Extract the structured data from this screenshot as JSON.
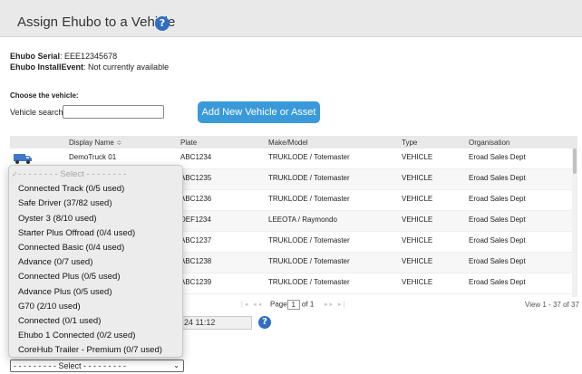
{
  "page": {
    "title": "Assign Ehubo to a Vehicle",
    "help_glyph": "?"
  },
  "info": {
    "serial_label": "Ehubo Serial",
    "serial_value": "EEE12345678",
    "install_label": "Ehubo InstallEvent",
    "install_value": "Not currently available"
  },
  "vehicle": {
    "choose_label": "Choose the vehicle:",
    "search_label": "Vehicle search",
    "search_value": "",
    "add_button": "Add New Vehicle or Asset"
  },
  "table": {
    "columns": [
      "Display Name",
      "Plate",
      "Make/Model",
      "Type",
      "Organisation"
    ],
    "sort_glyph": "≑",
    "rows": [
      {
        "name": "DemoTruck 01",
        "plate": "ABC1234",
        "make": "TRUKLODE / Totemaster",
        "type": "VEHICLE",
        "org": "Eroad Sales Dept"
      },
      {
        "name": "",
        "plate": "ABC1235",
        "make": "TRUKLODE / Totemaster",
        "type": "VEHICLE",
        "org": "Eroad Sales Dept"
      },
      {
        "name": "",
        "plate": "ABC1236",
        "make": "TRUKLODE / Totemaster",
        "type": "VEHICLE",
        "org": "Eroad Sales Dept"
      },
      {
        "name": "",
        "plate": "DEF1234",
        "make": "LEEOTA / Raymondo",
        "type": "VEHICLE",
        "org": "Eroad Sales Dept"
      },
      {
        "name": "",
        "plate": "ABC1237",
        "make": "TRUKLODE / Totemaster",
        "type": "VEHICLE",
        "org": "Eroad Sales Dept"
      },
      {
        "name": "",
        "plate": "ABC1238",
        "make": "TRUKLODE / Totemaster",
        "type": "VEHICLE",
        "org": "Eroad Sales Dept"
      },
      {
        "name": "",
        "plate": "ABC1239",
        "make": "TRUKLODE / Totemaster",
        "type": "VEHICLE",
        "org": "Eroad Sales Dept"
      }
    ]
  },
  "pager": {
    "page_label": "Page",
    "page_value": "1",
    "of_label": "of 1",
    "first_prev": "|◂ ◂◂",
    "next_last": "▸▸ ▸|",
    "view": "View 1 - 37 of 37"
  },
  "date_field": {
    "value": "24 11:12"
  },
  "dropdown": {
    "check": "✓",
    "header": "- - - - - - - - Select - - - - - - - -",
    "options": [
      "Connected Track (0/5 used)",
      "Safe Driver (37/82 used)",
      "Oyster 3 (8/10 used)",
      "Starter Plus Offroad (0/4 used)",
      "Connected Basic (0/4 used)",
      "Advance (0/7 used)",
      "Connected Plus (0/5 used)",
      "Advance Plus (0/5 used)",
      "G70 (2/10 used)",
      "Connected (0/1 used)",
      "Ehubo 1 Connected (0/2 used)",
      "CoreHub Trailer - Premium (0/7 used)"
    ]
  },
  "select": {
    "value": "- - - - - - - - - Select - - - - - - - - -",
    "caret": "⌄"
  },
  "colors": {
    "accent": "#3a9ad9",
    "help_blue": "#2f6ec4"
  }
}
